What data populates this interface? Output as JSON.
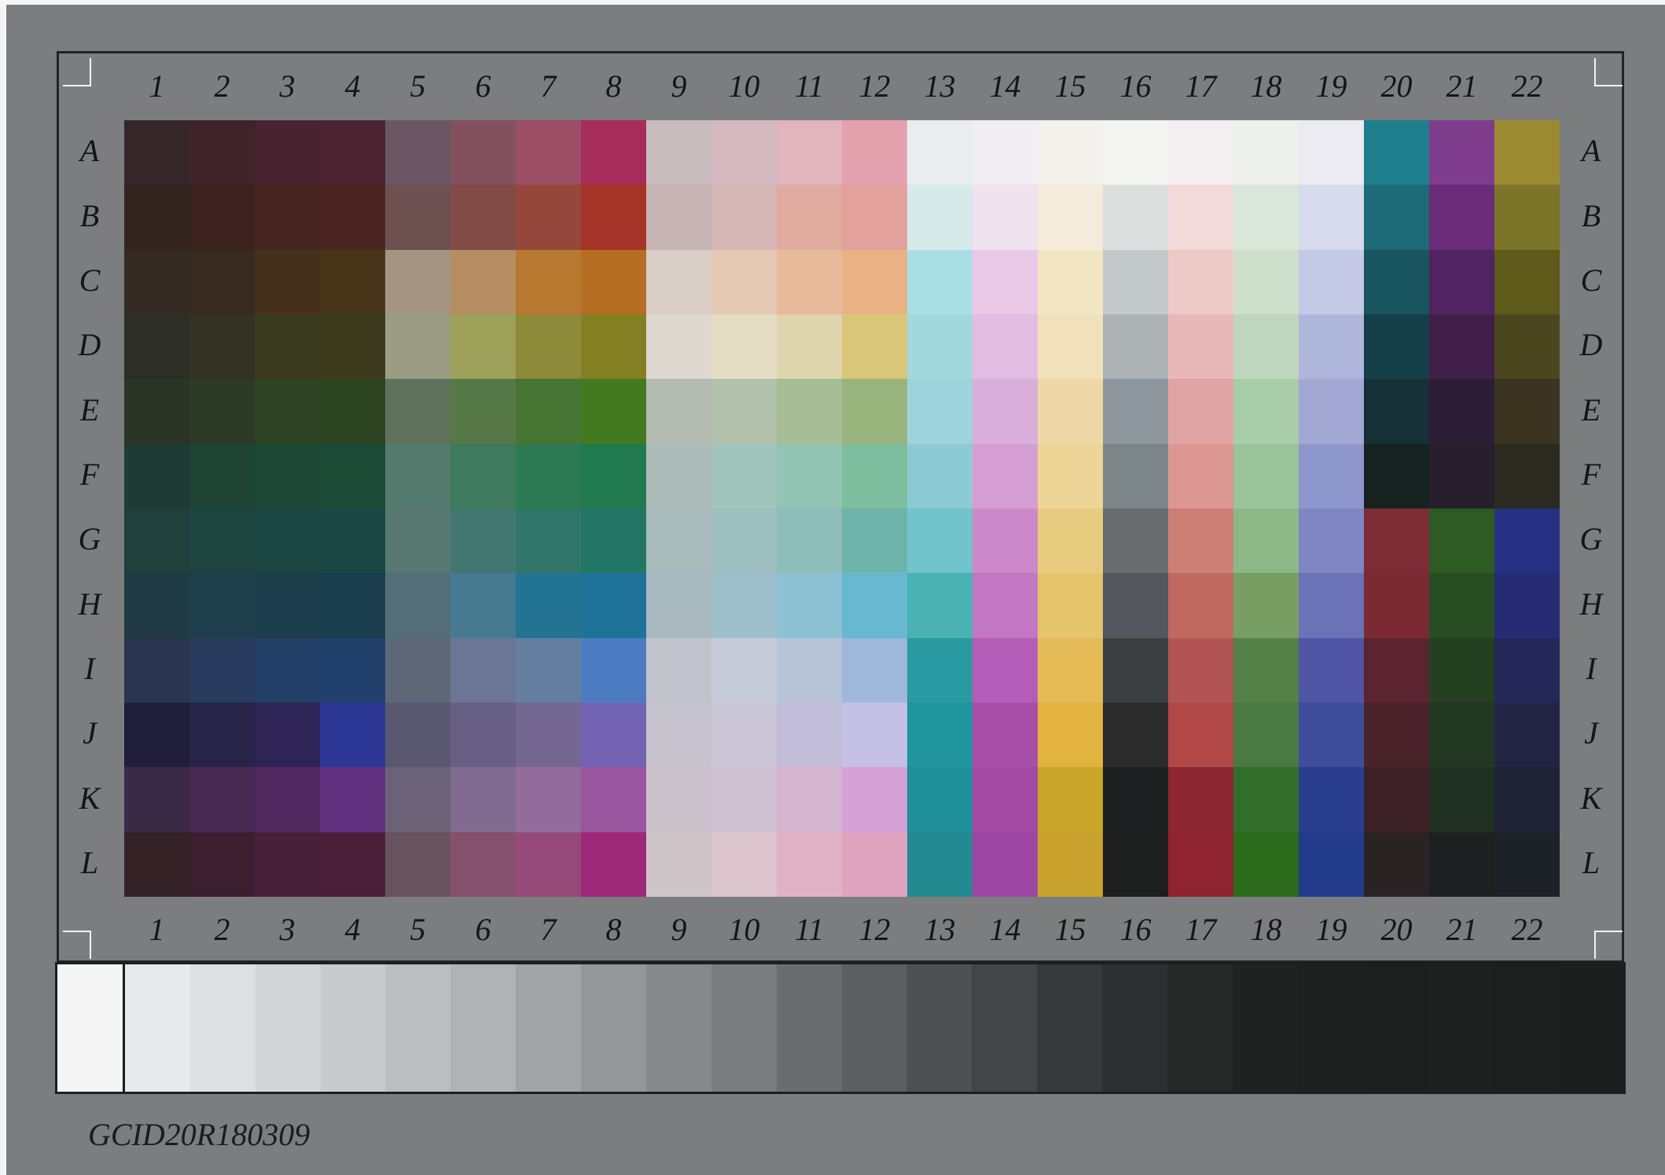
{
  "chart_id": "GCID20R180309",
  "columns": [
    "1",
    "2",
    "3",
    "4",
    "5",
    "6",
    "7",
    "8",
    "9",
    "10",
    "11",
    "12",
    "13",
    "14",
    "15",
    "16",
    "17",
    "18",
    "19",
    "20",
    "21",
    "22"
  ],
  "rows": [
    "A",
    "B",
    "C",
    "D",
    "E",
    "F",
    "G",
    "H",
    "I",
    "J",
    "K",
    "L"
  ],
  "patches": [
    [
      "#352629",
      "#3e232b",
      "#482330",
      "#4d2332",
      "#6b5764",
      "#82505e",
      "#9b4e66",
      "#a72d5b",
      "#c8bcbf",
      "#d3b8bf",
      "#e2b4bb",
      "#e4a2ae",
      "#eaedef",
      "#f1eef3",
      "#f2f1ec",
      "#f4f4f3",
      "#f3eef0",
      "#eef0ec",
      "#ebebf1",
      "#1e7e8b",
      "#803c8c",
      "#9b8b30"
    ],
    [
      "#34241f",
      "#3b221e",
      "#462520",
      "#4b2523",
      "#6d5150",
      "#834b45",
      "#95473b",
      "#a63428",
      "#c7b4b4",
      "#d4b6b4",
      "#e1aba0",
      "#e2a19a",
      "#d6eaea",
      "#f0e2ef",
      "#f4ebdc",
      "#dbe0df",
      "#f2d9da",
      "#dbe6da",
      "#d8dbeb",
      "#1c6b76",
      "#6a2b78",
      "#7c7428"
    ],
    [
      "#332b23",
      "#392a1f",
      "#45301c",
      "#483419",
      "#a39581",
      "#b48d63",
      "#b7782f",
      "#b66f22",
      "#d9cec6",
      "#e4c9b3",
      "#e8ba9c",
      "#e8b285",
      "#a9dfe4",
      "#eac8e8",
      "#f1e5c3",
      "#c4c9cb",
      "#edc9c8",
      "#cee0cc",
      "#c4c9e6",
      "#18555e",
      "#4f2460",
      "#5e5a1a"
    ],
    [
      "#2d2e25",
      "#323322",
      "#39391d",
      "#3b3a1d",
      "#9a9d84",
      "#9ea15a",
      "#8d8a39",
      "#828022",
      "#ddd9d0",
      "#e4ddc3",
      "#ded4ae",
      "#dac678",
      "#a2d7dd",
      "#e2bde2",
      "#f1e1bb",
      "#acb1b4",
      "#e8b8b8",
      "#bed6bd",
      "#aeb6dc",
      "#143f49",
      "#402048",
      "#4a461d"
    ],
    [
      "#2b3527",
      "#2d3a26",
      "#2e4224",
      "#2c4422",
      "#60725c",
      "#567847",
      "#477533",
      "#437a1f",
      "#b4bcb2",
      "#b1c1ac",
      "#a6bc94",
      "#98b47c",
      "#9dd4dc",
      "#d9aedb",
      "#efd7a8",
      "#8f979e",
      "#e1a4a4",
      "#a9cca9",
      "#a2a7d3",
      "#163038",
      "#2c1f35",
      "#3a3420"
    ],
    [
      "#1f3b33",
      "#1f4335",
      "#1d4836",
      "#1c4a35",
      "#557a6e",
      "#3f795e",
      "#2c7a53",
      "#217a4f",
      "#acbab8",
      "#a1c4bc",
      "#93c3b3",
      "#7cbe9e",
      "#8ccad4",
      "#d49dd4",
      "#ecd596",
      "#7c8688",
      "#dc9792",
      "#99c49b",
      "#8e97cc",
      "#16221f",
      "#271f2c",
      "#2a2a20"
    ],
    [
      "#1f403b",
      "#1d443f",
      "#1b4540",
      "#1a4742",
      "#587872",
      "#417770",
      "#327669",
      "#237565",
      "#a9bbbb",
      "#9ebfbf",
      "#8ebcb8",
      "#6fb4ab",
      "#71c3cc",
      "#cb89ca",
      "#e7cb7f",
      "#6a6d70",
      "#cd7f75",
      "#8cb888",
      "#8086c3",
      "#7d2c36",
      "#2e5a24",
      "#263184"
    ],
    [
      "#1f3a42",
      "#1e3e4b",
      "#1c3e4c",
      "#1b3e4e",
      "#546e78",
      "#467a90",
      "#227492",
      "#1f7399",
      "#a8bac0",
      "#9dc0cc",
      "#8bc1d3",
      "#69b8d1",
      "#4ab2b2",
      "#c276c4",
      "#e5c46c",
      "#53565d",
      "#c0695f",
      "#799e64",
      "#6c72b6",
      "#7b2a34",
      "#294d23",
      "#262b74"
    ],
    [
      "#2a3552",
      "#283b5e",
      "#233f67",
      "#20406b",
      "#5d6778",
      "#6c7596",
      "#657ea0",
      "#4b7cc1",
      "#c1c3cc",
      "#c5cbd8",
      "#b7c4d8",
      "#9eb7db",
      "#2a9aa2",
      "#b45db8",
      "#e4bb57",
      "#3c3f42",
      "#b35454",
      "#548147",
      "#5055a5",
      "#5b2430",
      "#244020",
      "#242859"
    ],
    [
      "#201e38",
      "#272447",
      "#2f2456",
      "#2d3795",
      "#5a5870",
      "#675f84",
      "#736792",
      "#7364b3",
      "#c7c3ce",
      "#cbc7d6",
      "#c1bcd8",
      "#c4c0e6",
      "#20959e",
      "#a84ea8",
      "#e2b43f",
      "#2b2b2c",
      "#b24747",
      "#4a7a41",
      "#3e4e9c",
      "#4a2229",
      "#223822",
      "#222443"
    ],
    [
      "#3b2a45",
      "#482954",
      "#512860",
      "#61307e",
      "#6c6278",
      "#806a90",
      "#946c9c",
      "#9a559f",
      "#cbc3cb",
      "#d0c2d2",
      "#d5b4d0",
      "#d6a2d6",
      "#1f8f9a",
      "#a34aa2",
      "#c9a629",
      "#1c1f1f",
      "#8c2630",
      "#336d2a",
      "#2a3e8e",
      "#3c2226",
      "#203023",
      "#1f2336"
    ],
    [
      "#352227",
      "#3c1f2e",
      "#471f36",
      "#4c1f39",
      "#69535f",
      "#85506b",
      "#954a7a",
      "#9d2878",
      "#cfc4c8",
      "#dcc4cd",
      "#e0b1c4",
      "#e1a4c0",
      "#238a92",
      "#9e47a2",
      "#c9a22e",
      "#1d1f1e",
      "#8f232f",
      "#2c6b1b",
      "#233b8b",
      "#2a2323",
      "#1d2020",
      "#1d2229"
    ]
  ],
  "gray_steps": [
    "#f4f5f4",
    "#e8e9ea",
    "#dedfe0",
    "#d3d4d6",
    "#c9cacc",
    "#bcbdbf",
    "#b0b2b3",
    "#a1a3a4",
    "#949697",
    "#878889",
    "#7b7c7d",
    "#6b6c6d",
    "#5d5e5f",
    "#4f5051",
    "#434546",
    "#38393a",
    "#2e2f30",
    "#262727",
    "#202121",
    "#1e201f",
    "#1d1f1f",
    "#1e2020",
    "#1d1f1f",
    "#1c1e1e"
  ]
}
